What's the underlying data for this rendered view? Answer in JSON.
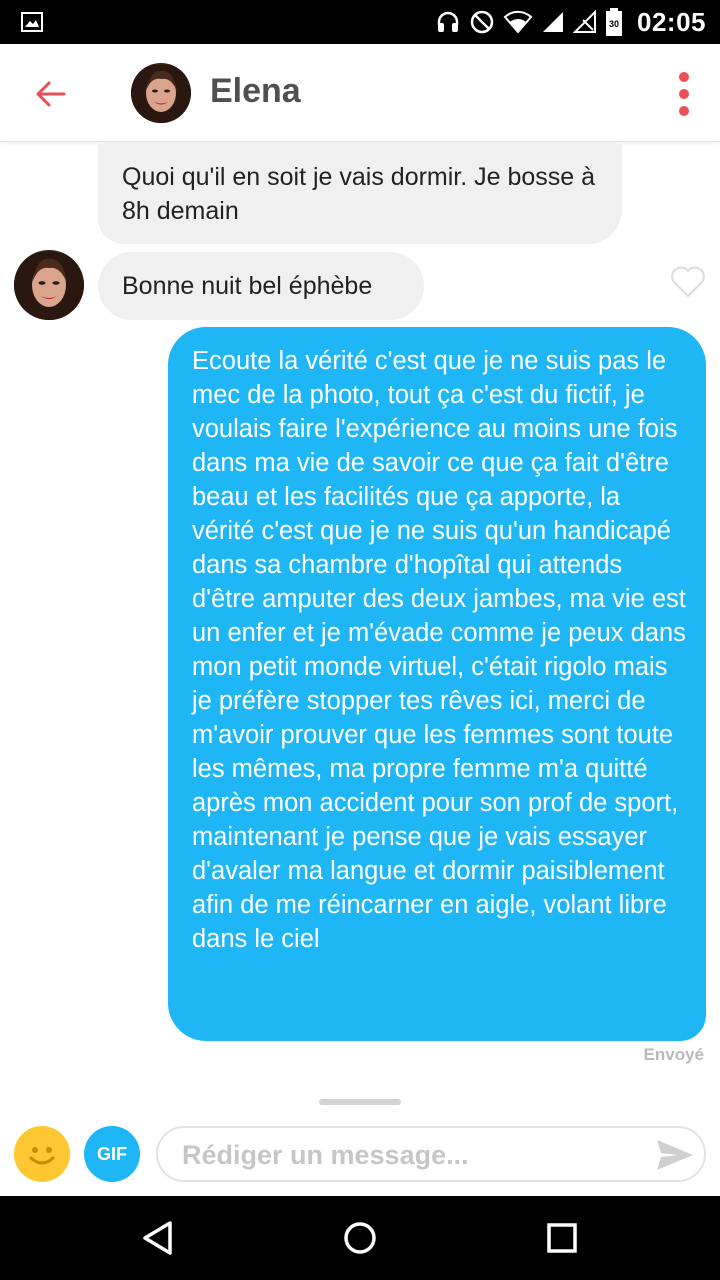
{
  "status_bar": {
    "time": "02:05",
    "battery_level": "30",
    "icons": [
      "gallery-icon",
      "headphones-icon",
      "no-disturb-icon",
      "wifi-icon",
      "signal-icon",
      "no-signal-icon",
      "battery-icon"
    ]
  },
  "header": {
    "contact_name": "Elena",
    "icons": [
      "back-arrow-icon",
      "more-vert-icon"
    ],
    "accent_color": "#ea4f57"
  },
  "messages": [
    {
      "direction": "received",
      "text": "Quoi qu'il en soit je vais dormir. Je bosse à 8h demain"
    },
    {
      "direction": "received",
      "text": "Bonne nuit bel éphèbe"
    },
    {
      "direction": "sent",
      "text": "Ecoute la vérité c'est que je ne suis pas le mec de la photo, tout ça c'est du fictif, je voulais faire l'expérience au moins une fois dans ma vie de savoir ce que ça fait d'être beau et les facilités que ça apporte, la vérité c'est que je ne suis qu'un handicapé dans sa chambre d'hopîtal qui attends d'être amputer des deux jambes, ma vie est un enfer et je m'évade comme je peux dans mon petit monde virtuel, c'était rigolo mais je préfère stopper tes rêves ici, merci de m'avoir prouver que les femmes sont toute les mêmes, ma propre femme m'a quitté après mon accident pour son prof de sport, maintenant je pense que je vais essayer d'avaler ma langue et dormir paisiblement afin de me réincarner en aigle, volant libre dans le ciel"
    }
  ],
  "sent_status": "Envoyé",
  "composer": {
    "gif_label": "GIF",
    "placeholder": "Rédiger un message...",
    "value": ""
  },
  "colors": {
    "sent_bubble": "#1fb6f5",
    "received_bubble": "#f0f0f0",
    "emoji_button": "#fcc730"
  },
  "nav_icons": [
    "back-triangle-icon",
    "home-circle-icon",
    "recents-square-icon"
  ]
}
